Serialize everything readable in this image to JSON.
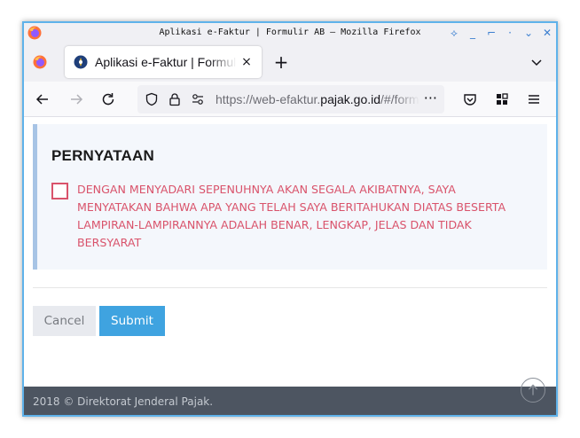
{
  "window": {
    "title": "Aplikasi e-Faktur | Formulir AB — Mozilla Firefox",
    "controls": [
      "pin-icon",
      "minimize-icon",
      "restore-icon",
      "dot-icon",
      "chevron-down-icon",
      "close-icon"
    ]
  },
  "tabs": [
    {
      "label": "Aplikasi e-Faktur | Formulir AB",
      "close": "×",
      "active": true
    }
  ],
  "newtab_label": "+",
  "urlbar": {
    "prefix": "https://web-efaktur.",
    "host": "pajak.go.id",
    "path": "/#/formulir",
    "more": "···"
  },
  "form": {
    "heading": "PERNYATAAN",
    "checkbox_checked": false,
    "statement": "DENGAN MENYADARI SEPENUHNYA AKAN SEGALA AKIBATNYA, SAYA MENYATAKAN BAHWA APA YANG TELAH SAYA BERITAHUKAN DIATAS BESERTA LAMPIRAN-LAMPIRANNYA ADALAH BENAR, LENGKAP, JELAS DAN TIDAK BERSYARAT",
    "cancel_label": "Cancel",
    "submit_label": "Submit"
  },
  "footer": {
    "text": "2018 © Direktorat Jenderal Pajak."
  },
  "colors": {
    "accent": "#3fa3e0",
    "statement": "#d9536b",
    "footer_bg": "#4d5561",
    "window_border": "#5fb2ea"
  }
}
